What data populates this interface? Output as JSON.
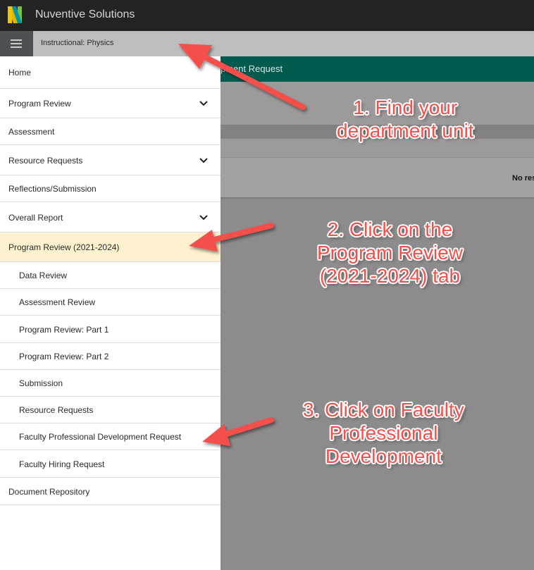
{
  "app": {
    "title": "Nuventive Solutions",
    "brand_colors": {
      "topbar": "#232323",
      "header": "#005a4f",
      "active_item": "#fcf2d0",
      "annotation": "#f4504c"
    }
  },
  "unit_bar": {
    "menu_icon": "hamburger-icon",
    "current_unit": "Instructional: Physics"
  },
  "content": {
    "header_title": "pment Request",
    "no_results_text": "No res"
  },
  "sidebar": {
    "items": [
      {
        "label": "Home",
        "expandable": false,
        "sub": false,
        "active": false
      },
      {
        "label": "Program Review",
        "expandable": true,
        "sub": false,
        "active": false
      },
      {
        "label": "Assessment",
        "expandable": false,
        "sub": false,
        "active": false
      },
      {
        "label": "Resource Requests",
        "expandable": true,
        "sub": false,
        "active": false
      },
      {
        "label": "Reflections/Submission",
        "expandable": false,
        "sub": false,
        "active": false
      },
      {
        "label": "Overall Report",
        "expandable": true,
        "sub": false,
        "active": false
      },
      {
        "label": "Program Review (2021-2024)",
        "expandable": false,
        "sub": false,
        "active": true
      },
      {
        "label": "Data Review",
        "expandable": false,
        "sub": true,
        "active": false
      },
      {
        "label": "Assessment Review",
        "expandable": false,
        "sub": true,
        "active": false
      },
      {
        "label": "Program Review: Part 1",
        "expandable": false,
        "sub": true,
        "active": false
      },
      {
        "label": "Program Review: Part 2",
        "expandable": false,
        "sub": true,
        "active": false
      },
      {
        "label": "Submission",
        "expandable": false,
        "sub": true,
        "active": false
      },
      {
        "label": "Resource Requests",
        "expandable": false,
        "sub": true,
        "active": false
      },
      {
        "label": "Faculty Professional Development Request",
        "expandable": false,
        "sub": true,
        "active": false
      },
      {
        "label": "Faculty Hiring Request",
        "expandable": false,
        "sub": true,
        "active": false
      },
      {
        "label": "Document Repository",
        "expandable": false,
        "sub": false,
        "active": false
      }
    ]
  },
  "annotations": {
    "step1": [
      "1. Find your",
      "department unit"
    ],
    "step2": [
      "2. Click on the",
      "Program Review",
      "(2021-2024) tab"
    ],
    "step3": [
      "3. Click on Faculty",
      "Professional",
      "Development"
    ]
  }
}
